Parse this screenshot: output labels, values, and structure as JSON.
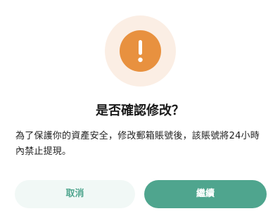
{
  "dialog": {
    "icon": "exclamation-warning-icon",
    "title": "是否確認修改？",
    "message": "為了保護你的資產安全，修改郵箱賬號後，該賬號將24小時內禁止提現。",
    "cancel_label": "取消",
    "confirm_label": "繼續"
  },
  "colors": {
    "warning_halo": "#fbeee4",
    "warning": "#e8913f",
    "accent": "#4fa58e",
    "cancel_bg": "#f1f8f6"
  }
}
